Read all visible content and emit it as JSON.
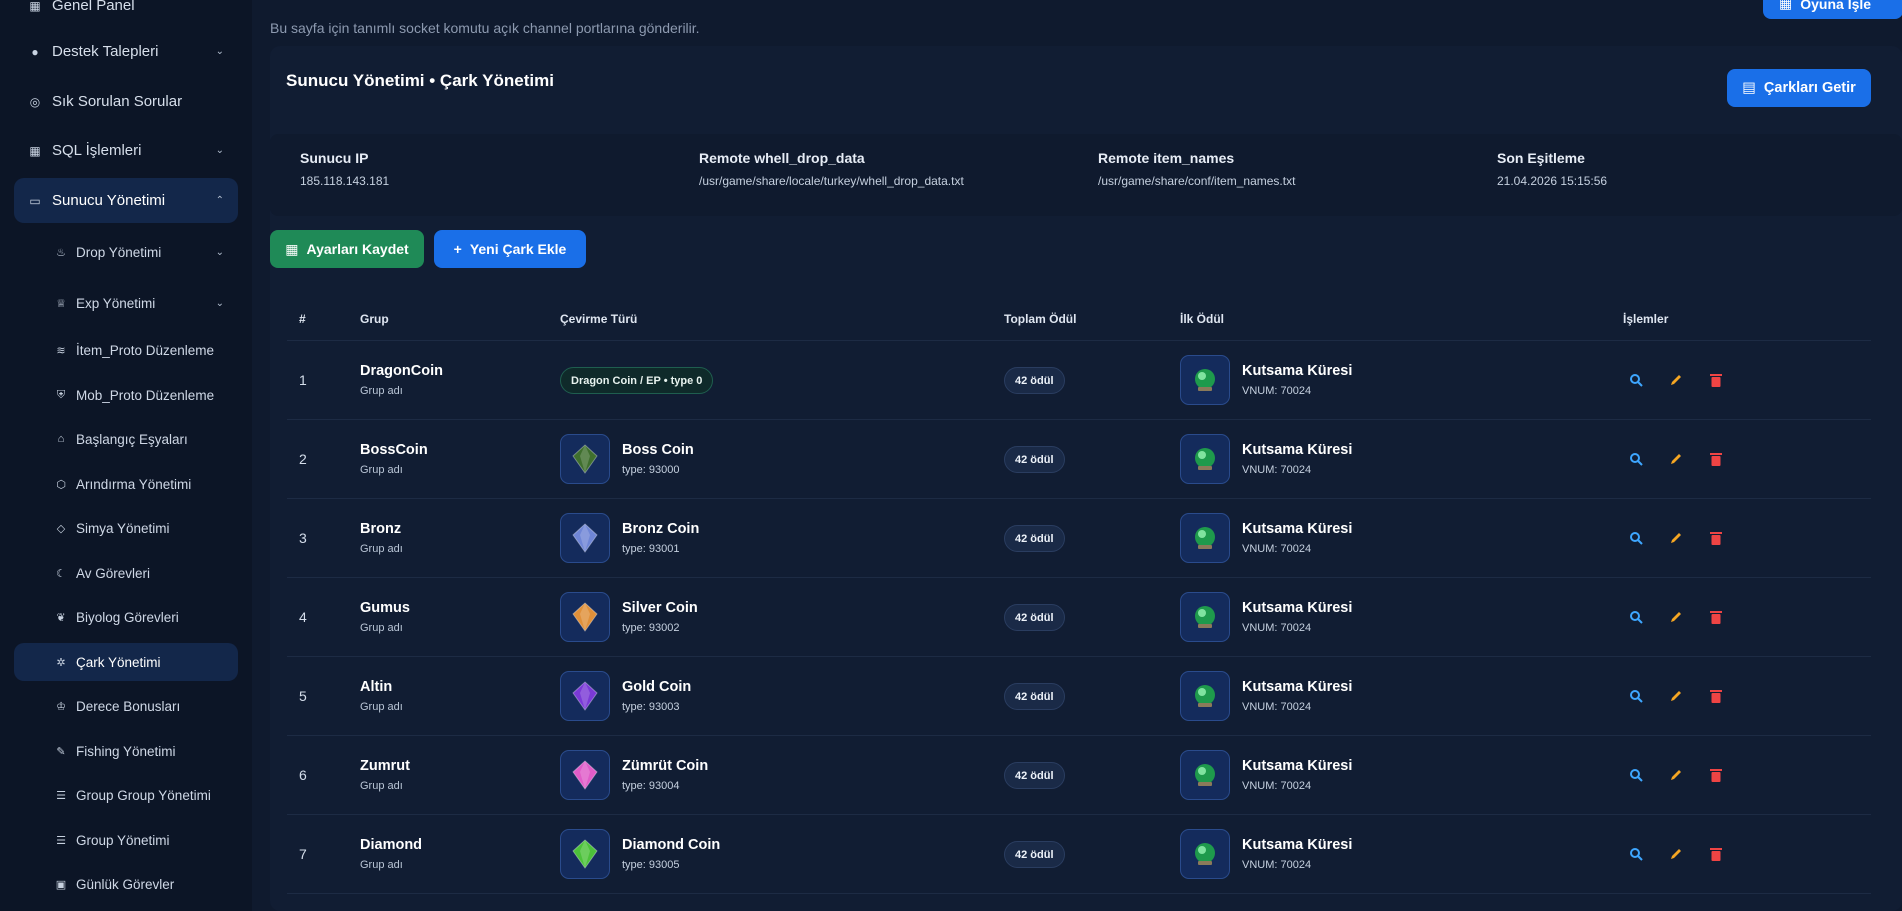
{
  "sidebar": {
    "items": [
      {
        "label": "Genel Panel",
        "icon": "grid-icon"
      },
      {
        "label": "Destek Talepleri",
        "icon": "question-circle-icon"
      },
      {
        "label": "Sık Sorulan Sorular",
        "icon": "help-circle-icon"
      },
      {
        "label": "SQL İşlemleri",
        "icon": "grid-icon"
      },
      {
        "label": "Sunucu Yönetimi",
        "icon": "monitor-icon"
      }
    ],
    "sub_items": [
      {
        "label": "Drop Yönetimi",
        "icon": "fire-icon"
      },
      {
        "label": "Exp Yönetimi",
        "icon": "trophy-icon"
      },
      {
        "label": "İtem_Proto Düzenleme",
        "icon": "layers-icon"
      },
      {
        "label": "Mob_Proto Düzenleme",
        "icon": "shield-icon"
      },
      {
        "label": "Başlangıç Eşyaları",
        "icon": "gift-icon"
      },
      {
        "label": "Arındırma Yönetimi",
        "icon": "box-icon"
      },
      {
        "label": "Simya Yönetimi",
        "icon": "gem-icon"
      },
      {
        "label": "Av Görevleri",
        "icon": "moon-icon"
      },
      {
        "label": "Biyolog Görevleri",
        "icon": "leaf-icon"
      },
      {
        "label": "Çark Yönetimi",
        "icon": "sun-icon"
      },
      {
        "label": "Derece Bonusları",
        "icon": "cup-icon"
      },
      {
        "label": "Fishing Yönetimi",
        "icon": "fish-icon"
      },
      {
        "label": "Group Group Yönetimi",
        "icon": "list-icon"
      },
      {
        "label": "Group Yönetimi",
        "icon": "list-icon"
      },
      {
        "label": "Günlük Görevler",
        "icon": "calendar-icon"
      }
    ]
  },
  "header": {
    "description": "Bu sayfa için tanımlı socket komutu açık channel portlarına gönderilir.",
    "top_button": "Oyuna İşle"
  },
  "panel": {
    "title": "Sunucu Yönetimi • Çark Yönetimi",
    "fetch_button": "Çarkları Getir"
  },
  "info": [
    {
      "key": "Sunucu IP",
      "value": "185.118.143.181"
    },
    {
      "key": "Remote whell_drop_data",
      "value": "/usr/game/share/locale/turkey/whell_drop_data.txt"
    },
    {
      "key": "Remote item_names",
      "value": "/usr/game/share/conf/item_names.txt"
    },
    {
      "key": "Son Eşitleme",
      "value": "21.04.2026 15:15:56"
    }
  ],
  "actions": {
    "save": "Ayarları Kaydet",
    "add": "Yeni Çark Ekle"
  },
  "table": {
    "headers": [
      "#",
      "Grup",
      "Çevirme Türü",
      "Toplam Ödül",
      "İlk Ödül",
      "İşlemler"
    ],
    "rows": [
      {
        "num": "1",
        "group": "DragonCoin",
        "group_sub": "Grup adı",
        "spin_pill": "Dragon Coin / EP • type 0",
        "spin_name": "",
        "spin_type": "",
        "gem": "",
        "total": "42 ödül",
        "reward": "Kutsama Küresi",
        "vnum": "VNUM: 70024"
      },
      {
        "num": "2",
        "group": "BossCoin",
        "group_sub": "Grup adı",
        "spin_pill": "",
        "spin_name": "Boss Coin",
        "spin_type": "type: 93000",
        "gem": "#3f6f2e",
        "total": "42 ödül",
        "reward": "Kutsama Küresi",
        "vnum": "VNUM: 70024"
      },
      {
        "num": "3",
        "group": "Bronz",
        "group_sub": "Grup adı",
        "spin_pill": "",
        "spin_name": "Bronz Coin",
        "spin_type": "type: 93001",
        "gem": "#6f86d6",
        "total": "42 ödül",
        "reward": "Kutsama Küresi",
        "vnum": "VNUM: 70024"
      },
      {
        "num": "4",
        "group": "Gumus",
        "group_sub": "Grup adı",
        "spin_pill": "",
        "spin_name": "Silver Coin",
        "spin_type": "type: 93002",
        "gem": "#e0903a",
        "total": "42 ödül",
        "reward": "Kutsama Küresi",
        "vnum": "VNUM: 70024"
      },
      {
        "num": "5",
        "group": "Altin",
        "group_sub": "Grup adı",
        "spin_pill": "",
        "spin_name": "Gold Coin",
        "spin_type": "type: 93003",
        "gem": "#7a3ad6",
        "total": "42 ödül",
        "reward": "Kutsama Küresi",
        "vnum": "VNUM: 70024"
      },
      {
        "num": "6",
        "group": "Zumrut",
        "group_sub": "Grup adı",
        "spin_pill": "",
        "spin_name": "Zümrüt Coin",
        "spin_type": "type: 93004",
        "gem": "#e05cc8",
        "total": "42 ödül",
        "reward": "Kutsama Küresi",
        "vnum": "VNUM: 70024"
      },
      {
        "num": "7",
        "group": "Diamond",
        "group_sub": "Grup adı",
        "spin_pill": "",
        "spin_name": "Diamond Coin",
        "spin_type": "type: 93005",
        "gem": "#4cc23a",
        "total": "42 ödül",
        "reward": "Kutsama Küresi",
        "vnum": "VNUM: 70024"
      }
    ]
  },
  "colors": {
    "accent": "#1a6fe8",
    "success": "#1f8a57",
    "search_icon": "#3ea6ff",
    "edit_icon": "#f5a623",
    "delete_icon": "#ef4444"
  }
}
